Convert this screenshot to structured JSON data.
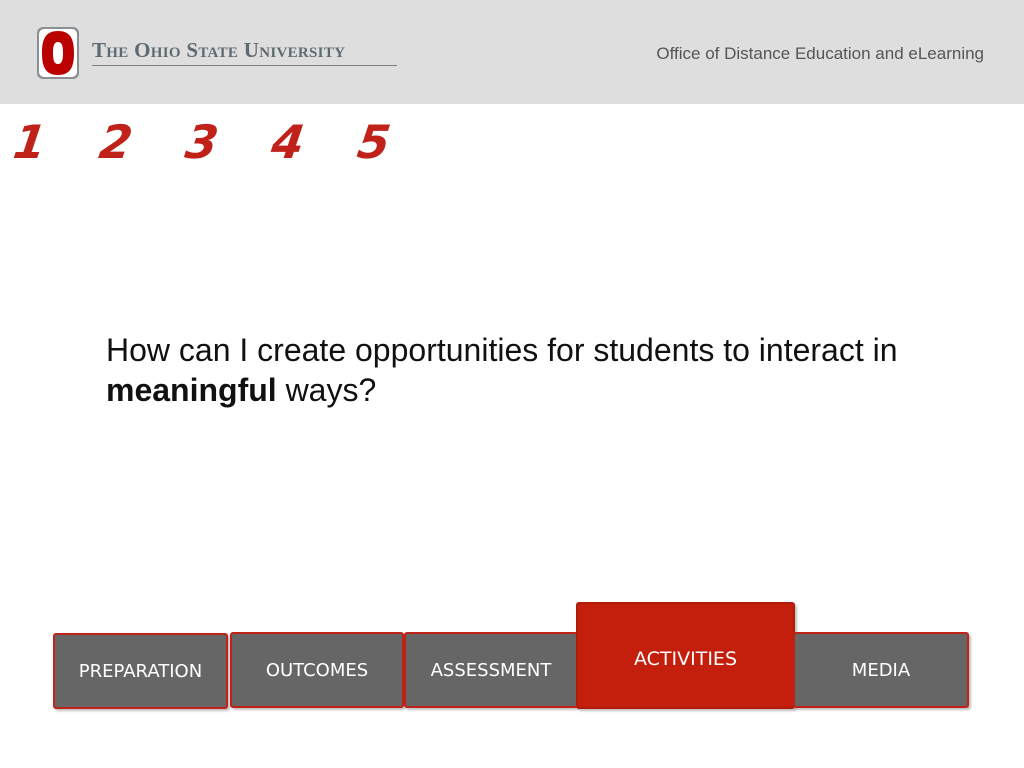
{
  "header": {
    "university_name": "The Ohio State University",
    "office_title": "Office of Distance Education and eLearning",
    "logo_letter": "O",
    "brand_color": "#bb0000",
    "header_bg": "#dedede"
  },
  "steps": [
    "1",
    "2",
    "3",
    "4",
    "5"
  ],
  "question": {
    "before": "How can I create opportunities for students to interact in ",
    "emphasis": "meaningful",
    "after": " ways?"
  },
  "tabs": [
    {
      "label": "PREPARATION",
      "active": false
    },
    {
      "label": "OUTCOMES",
      "active": false
    },
    {
      "label": "ASSESSMENT",
      "active": false
    },
    {
      "label": "ACTIVITIES",
      "active": true
    },
    {
      "label": "MEDIA",
      "active": false
    }
  ],
  "colors": {
    "accent_red": "#c41e0c",
    "tab_gray": "#666666",
    "step_red": "#c0221a"
  }
}
